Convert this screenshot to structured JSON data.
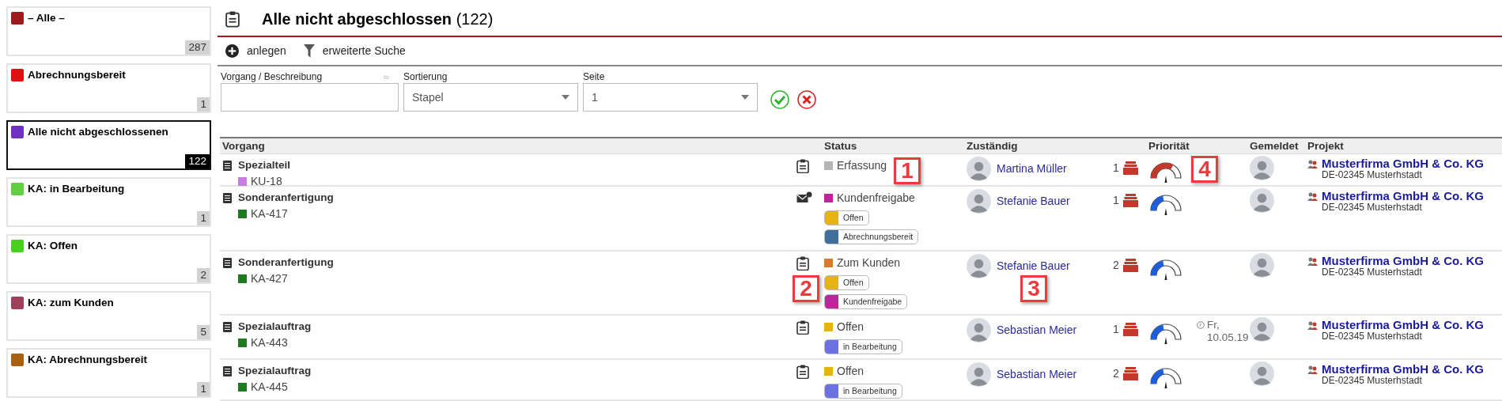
{
  "sidebar": {
    "items": [
      {
        "label": "– Alle –",
        "count": "287",
        "color": "#9b1c1c",
        "selected": false
      },
      {
        "label": "Abrechnungsbereit",
        "count": "1",
        "color": "#e01010",
        "selected": false
      },
      {
        "label": "Alle nicht abgeschlossenen",
        "count": "122",
        "color": "#7030c0",
        "selected": true
      },
      {
        "label": "KA: in Bearbeitung",
        "count": "1",
        "color": "#60d040",
        "selected": false
      },
      {
        "label": "KA: Offen",
        "count": "2",
        "color": "#48d020",
        "selected": false
      },
      {
        "label": "KA: zum Kunden",
        "count": "5",
        "color": "#a04058",
        "selected": false
      },
      {
        "label": "KA: Abrechnungsbereit",
        "count": "1",
        "color": "#a86010",
        "selected": false
      }
    ]
  },
  "header": {
    "title": "**Alle nicht abgeschlossen** (122)"
  },
  "toolbar": [
    {
      "kind": "create",
      "label": "anlegen"
    },
    {
      "kind": "filter",
      "label": "erweiterte Suche"
    }
  ],
  "filters": [
    {
      "kind": "text",
      "label": "Vorgang / Beschreibung"
    },
    {
      "kind": "select",
      "label": "Sortierung",
      "value": "Stapel"
    },
    {
      "kind": "select",
      "label": "Seite",
      "value": "1"
    }
  ],
  "table": {
    "columns": [
      "Vorgang",
      "Status",
      "Zuständig",
      "Priorität",
      "Gemeldet",
      "Projekt"
    ],
    "rows": [
      {
        "title": "Spezialteil",
        "code": {
          "label": "KU-18",
          "color": "#c87de0"
        },
        "kind": "clipboard",
        "status": {
          "label": "Erfassung",
          "color": "#b4b4b4",
          "callout": "1"
        },
        "tags": [],
        "assignee": {
          "name": "Martina Müller"
        },
        "count": "1",
        "priority": {
          "level": 0.75,
          "color": "#c0392b",
          "callout": "4"
        },
        "project": "Musterfirma GmbH & Co. KG",
        "address": "DE-02345 Musterhstadt"
      },
      {
        "title": "Sonderanfertigung",
        "code": {
          "label": "KA-417",
          "color": "#1e7a1e"
        },
        "kind": "mail",
        "status": {
          "label": "Kundenfreigabe",
          "color": "#c0249c"
        },
        "tags": [
          {
            "label": "Offen",
            "color": "#e6b412"
          },
          {
            "label": "Abrechnungsbereit",
            "color": "#3f6f9a"
          }
        ],
        "assignee": {
          "name": "Stefanie Bauer"
        },
        "count": "1",
        "priority": {
          "level": 0.4,
          "color": "#1e5fd8"
        },
        "project": "Musterfirma GmbH & Co. KG",
        "address": "DE-02345 Musterhstadt"
      },
      {
        "title": "Sonderanfertigung",
        "code": {
          "label": "KA-427",
          "color": "#1e7a1e"
        },
        "kind": "clipboard",
        "status": {
          "label": "Zum Kunden",
          "color": "#d97a2b"
        },
        "tags": [
          {
            "label": "Offen",
            "color": "#e6b412"
          },
          {
            "label": "Kundenfreigabe",
            "color": "#c0249c",
            "callout": "2"
          }
        ],
        "assignee": {
          "name": "Stefanie Bauer",
          "callout": "3"
        },
        "count": "2",
        "priority": {
          "level": 0.4,
          "color": "#1e5fd8"
        },
        "project": "Musterfirma GmbH & Co. KG",
        "address": "DE-02345 Musterhstadt"
      },
      {
        "title": "Spezialauftrag",
        "code": {
          "label": "KA-443",
          "color": "#1e7a1e"
        },
        "kind": "clipboard",
        "status": {
          "label": "Offen",
          "color": "#e6b412"
        },
        "tags": [
          {
            "label": "in Bearbeitung",
            "color": "#6b72e0"
          }
        ],
        "assignee": {
          "name": "Sebastian Meier"
        },
        "count": "1",
        "priority": {
          "level": 0.4,
          "color": "#1e5fd8"
        },
        "date": "Fr, 10.05.19",
        "project": "Musterfirma GmbH & Co. KG",
        "address": "DE-02345 Musterhstadt"
      },
      {
        "title": "Spezialauftrag",
        "code": {
          "label": "KA-445",
          "color": "#1e7a1e"
        },
        "kind": "clipboard",
        "status": {
          "label": "Offen",
          "color": "#e6b412"
        },
        "tags": [
          {
            "label": "in Bearbeitung",
            "color": "#6b72e0"
          }
        ],
        "assignee": {
          "name": "Sebastian Meier"
        },
        "count": "2",
        "priority": {
          "level": 0.4,
          "color": "#1e5fd8"
        },
        "project": "Musterfirma GmbH & Co. KG",
        "address": "DE-02345 Musterhstadt"
      }
    ]
  }
}
